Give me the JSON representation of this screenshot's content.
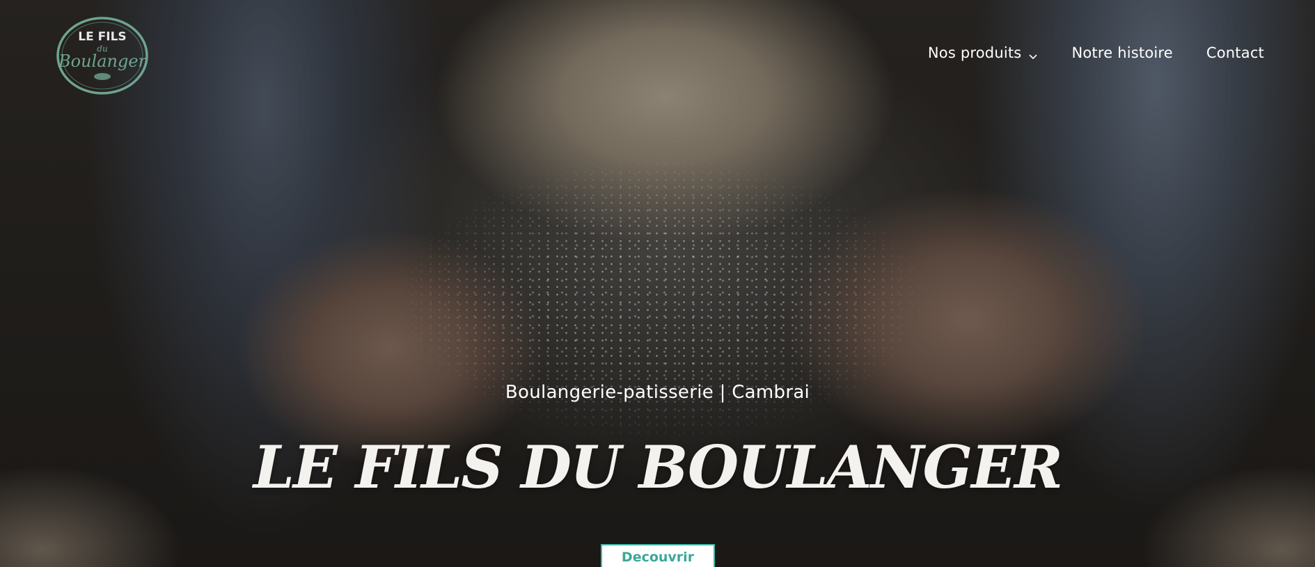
{
  "brand": {
    "logo_line1": "LE FILS",
    "logo_line2": "du",
    "logo_line3": "Boulanger",
    "logo_color": "#6fa48f"
  },
  "nav": {
    "items": [
      {
        "label": "Nos produits",
        "has_dropdown": true,
        "icon": "chevron-down-icon"
      },
      {
        "label": "Notre histoire"
      },
      {
        "label": "Contact"
      }
    ]
  },
  "hero": {
    "subtitle": "Boulangerie-patisserie | Cambrai",
    "title": "LE FILS DU BOULANGER",
    "cta_label": "Decouvrir"
  },
  "colors": {
    "accent": "#44b8a8",
    "text": "#ffffff"
  }
}
